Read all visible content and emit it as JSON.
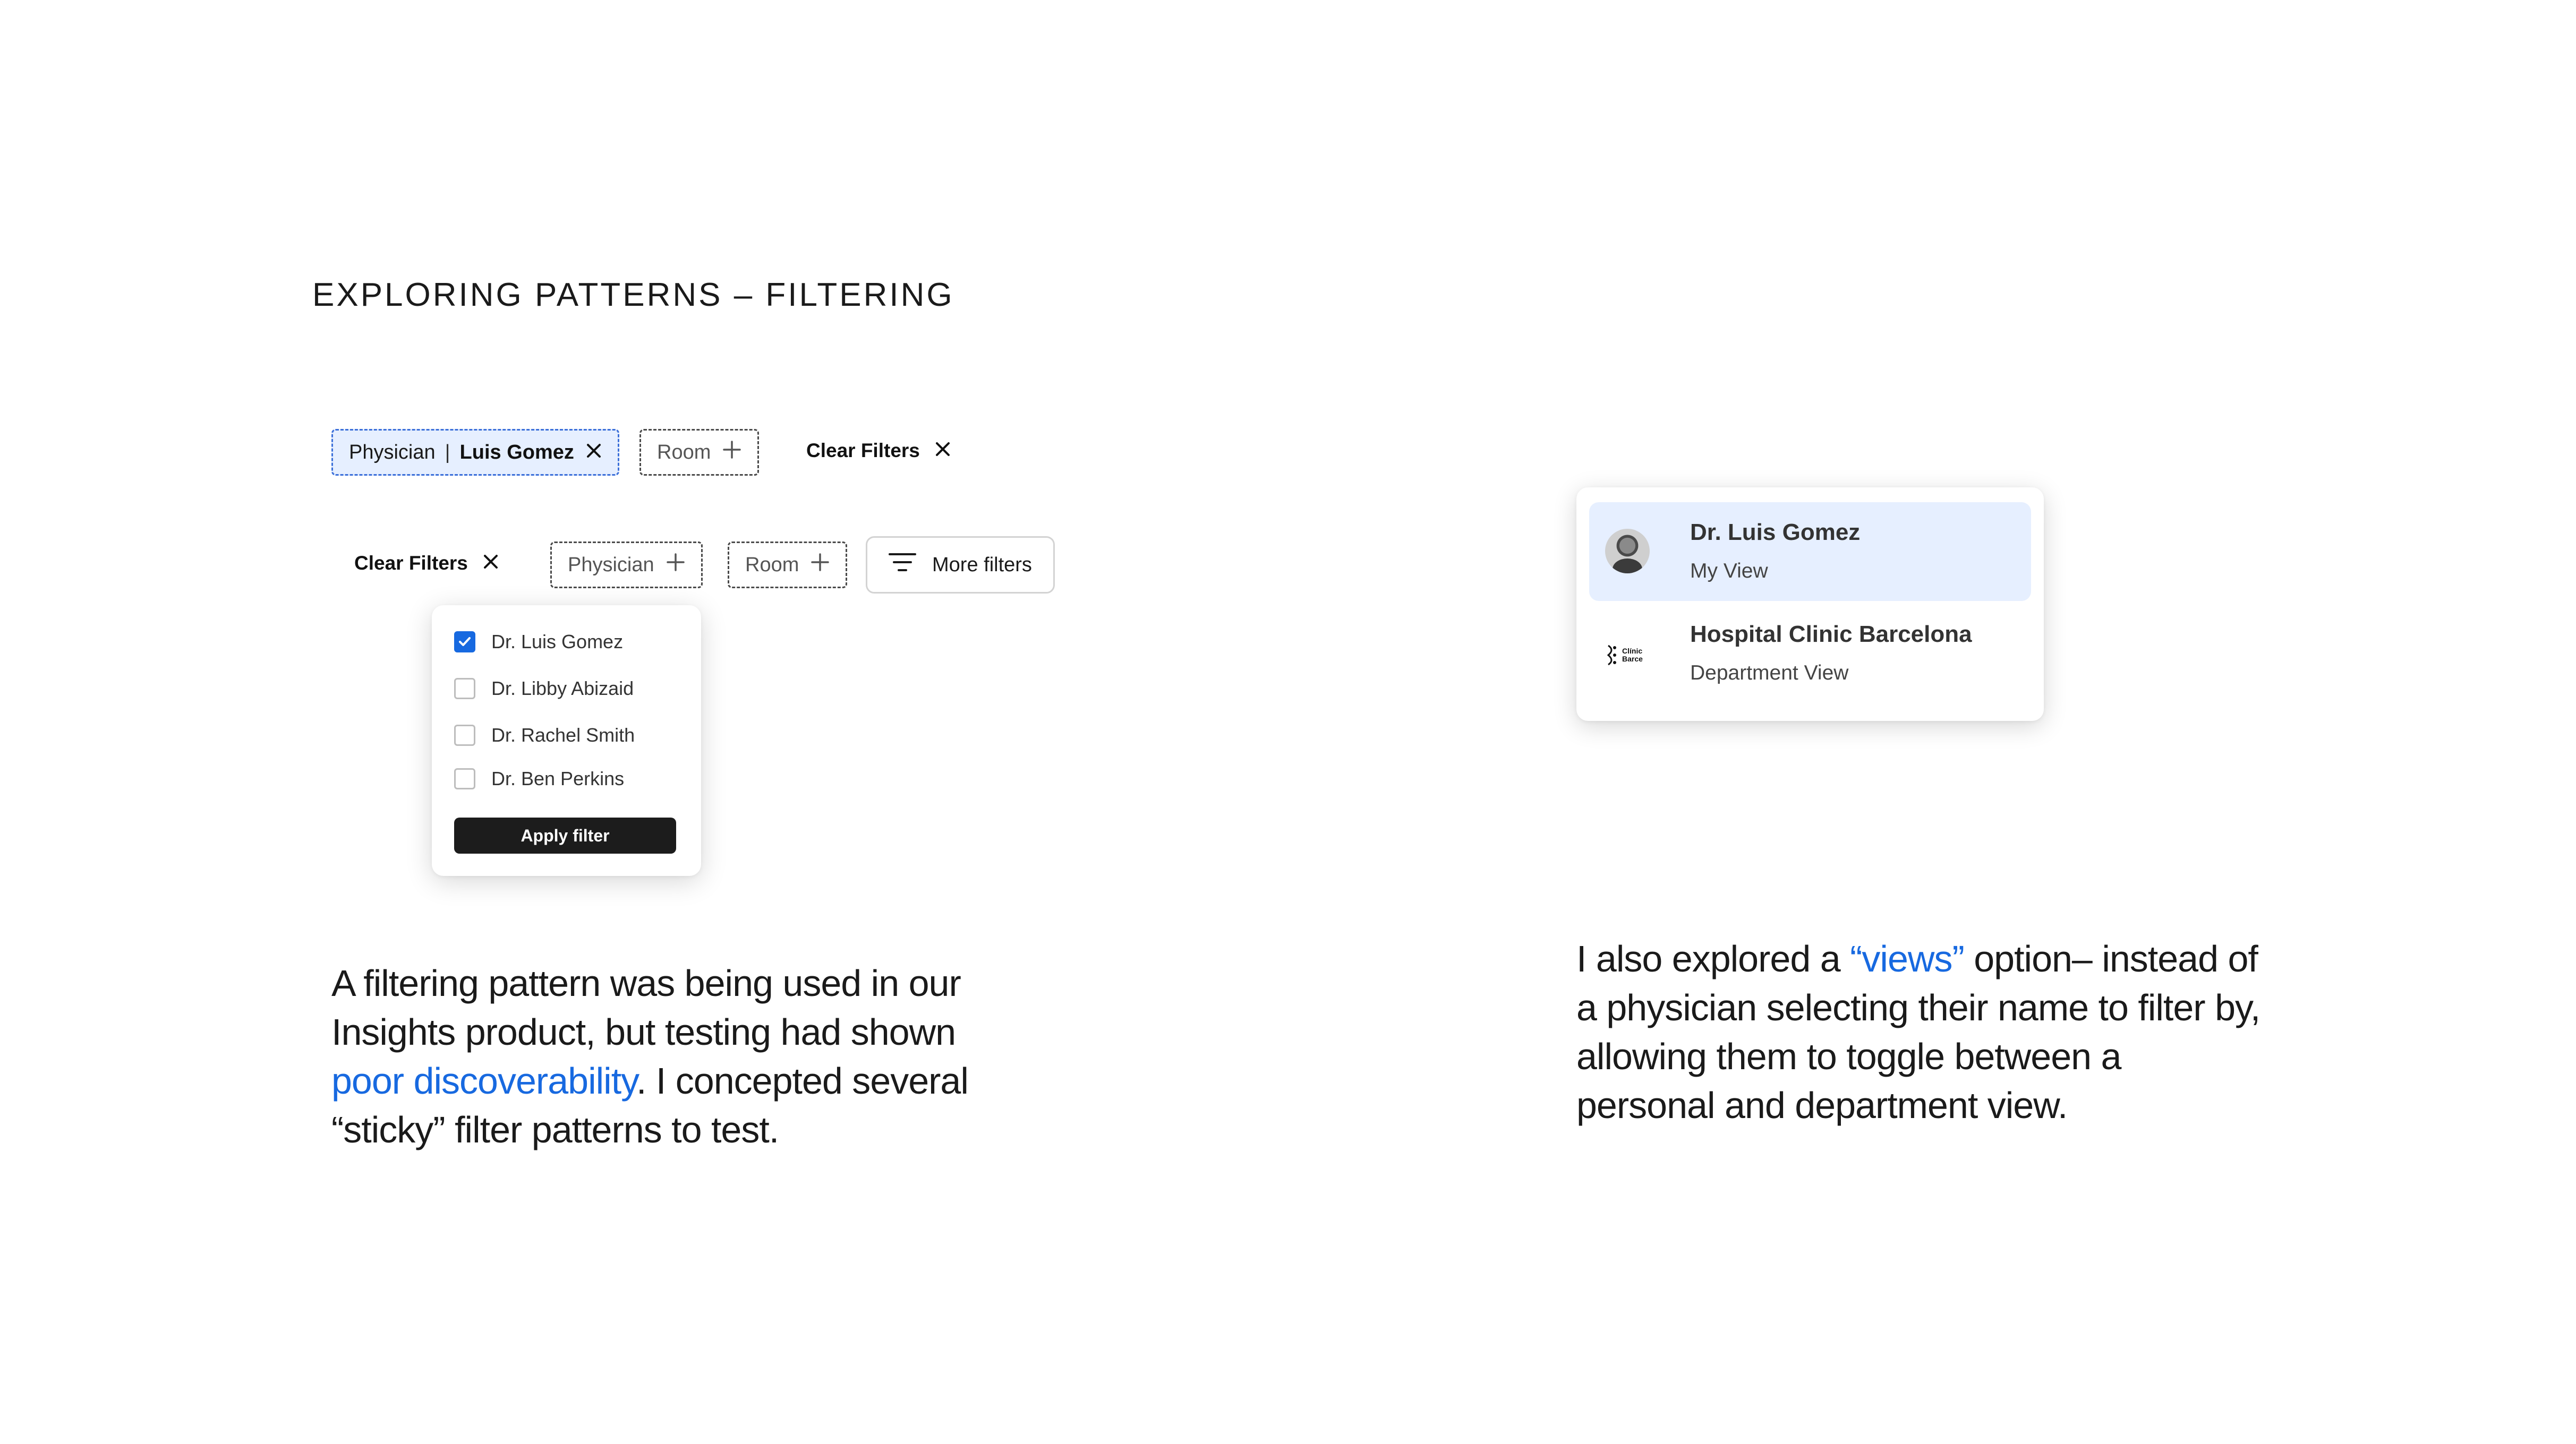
{
  "section_title": "EXPLORING PATTERNS – FILTERING",
  "row1": {
    "active_chip": {
      "label": "Physician",
      "separator": "|",
      "value": "Luis Gomez",
      "icon": "close-icon"
    },
    "room_chip": {
      "label": "Room",
      "icon": "plus-icon"
    },
    "clear": {
      "label": "Clear Filters",
      "icon": "close-icon"
    }
  },
  "row2": {
    "clear": {
      "label": "Clear Filters",
      "icon": "close-icon"
    },
    "physician_chip": {
      "label": "Physician",
      "icon": "plus-icon"
    },
    "room_chip": {
      "label": "Room",
      "icon": "plus-icon"
    },
    "more_filters": {
      "label": "More filters",
      "icon": "filter-lines-icon"
    }
  },
  "dropdown": {
    "options": [
      {
        "label": "Dr. Luis Gomez",
        "checked": true
      },
      {
        "label": "Dr. Libby Abizaid",
        "checked": false
      },
      {
        "label": "Dr. Rachel Smith",
        "checked": false
      },
      {
        "label": "Dr. Ben Perkins",
        "checked": false
      }
    ],
    "apply_label": "Apply filter"
  },
  "left_text": {
    "line1": "A filtering pattern was being used in our",
    "line2": "Insights product, but testing had shown",
    "line3_highlight": "poor discoverability",
    "line3_rest": ". I concepted several",
    "line4": "“sticky” filter patterns to test."
  },
  "views": {
    "items": [
      {
        "name": "Dr. Luis Gomez",
        "sub": "My View",
        "selected": true
      },
      {
        "name": "Hospital Clinic Barcelona",
        "sub": "Department View",
        "selected": false
      }
    ],
    "logo_text_1": "Clínic",
    "logo_text_2": "Barce"
  },
  "right_text": {
    "line1_a": "I also explored a ",
    "line1_highlight": "“views”",
    "line1_b": " option– instead of",
    "line2": "a physician selecting their name to filter by,",
    "line3": "allowing them to toggle between a",
    "line4": "personal and department view."
  },
  "colors": {
    "accent": "#1769e0",
    "chip_active_bg": "#e6efff",
    "dark_button": "#1c1c1c"
  }
}
